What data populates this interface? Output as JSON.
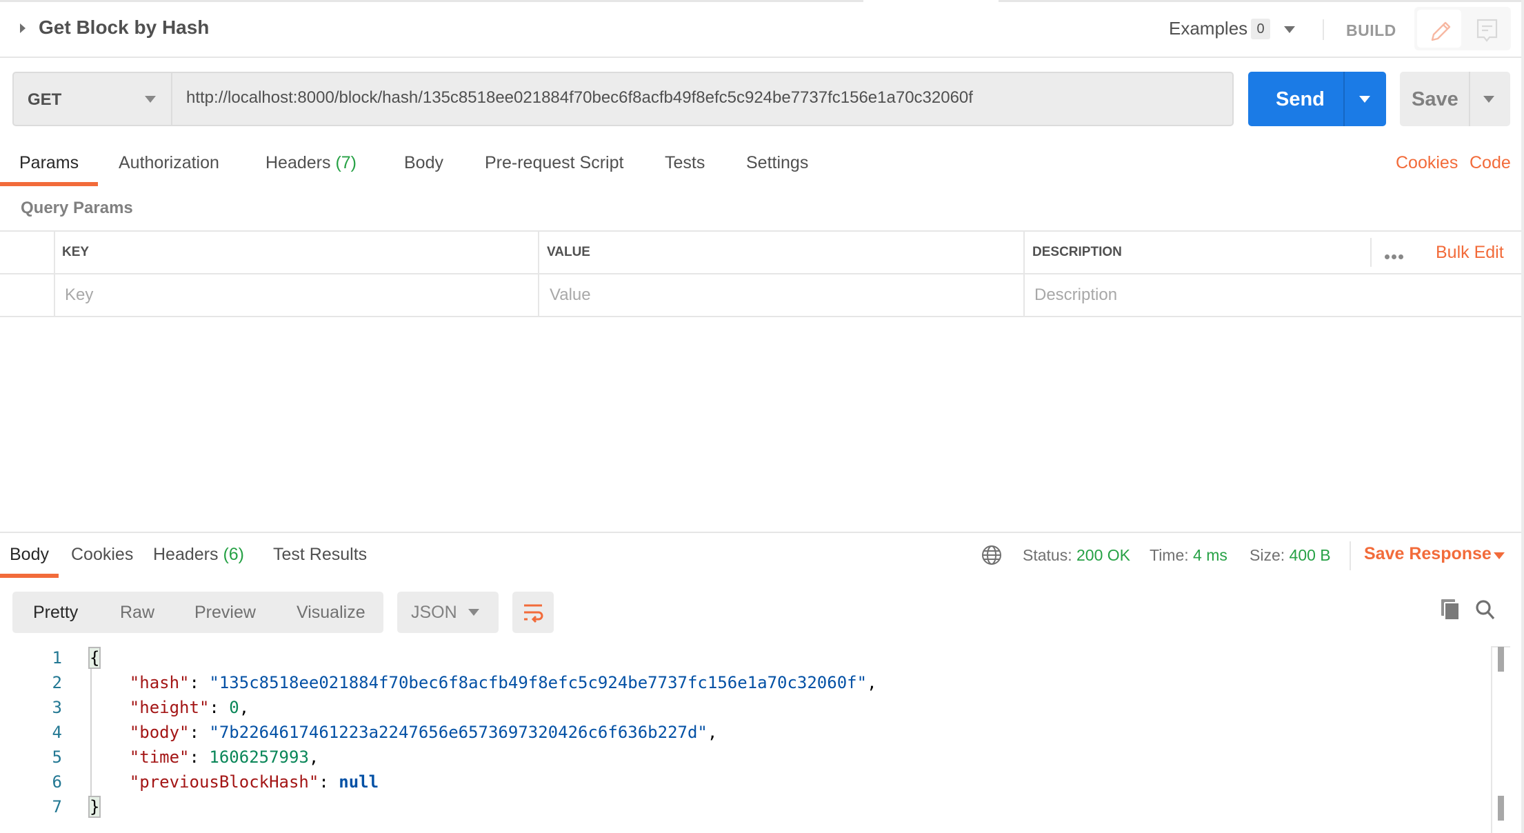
{
  "request": {
    "title": "Get Block by Hash",
    "examples_label": "Examples",
    "examples_count": "0",
    "mode_label": "BUILD",
    "method": "GET",
    "url": "http://localhost:8000/block/hash/135c8518ee021884f70bec6f8acfb49f8efc5c924be7737fc156e1a70c32060f",
    "send_label": "Send",
    "save_label": "Save",
    "tabs": [
      {
        "label": "Params",
        "count": "",
        "active": true
      },
      {
        "label": "Authorization",
        "count": ""
      },
      {
        "label": "Headers",
        "count": "(7)"
      },
      {
        "label": "Body",
        "count": ""
      },
      {
        "label": "Pre-request Script",
        "count": ""
      },
      {
        "label": "Tests",
        "count": ""
      },
      {
        "label": "Settings",
        "count": ""
      }
    ],
    "links": {
      "cookies": "Cookies",
      "code": "Code"
    },
    "query_params": {
      "title": "Query Params",
      "columns": [
        "KEY",
        "VALUE",
        "DESCRIPTION"
      ],
      "placeholders": {
        "key": "Key",
        "value": "Value",
        "description": "Description"
      },
      "bulk_edit_label": "Bulk Edit"
    }
  },
  "response": {
    "tabs": [
      {
        "label": "Body",
        "active": true
      },
      {
        "label": "Cookies"
      },
      {
        "label": "Headers",
        "count": "(6)"
      },
      {
        "label": "Test Results"
      }
    ],
    "status": {
      "label": "Status:",
      "value": "200 OK"
    },
    "time": {
      "label": "Time:",
      "value": "4 ms"
    },
    "size": {
      "label": "Size:",
      "value": "400 B"
    },
    "save_response_label": "Save Response",
    "formats": [
      "Pretty",
      "Raw",
      "Preview",
      "Visualize"
    ],
    "active_format": "Pretty",
    "language": "JSON",
    "body_lines": [
      {
        "num": "1",
        "text": "{"
      },
      {
        "num": "2",
        "key": "\"hash\"",
        "value": "\"135c8518ee021884f70bec6f8acfb49f8efc5c924be7737fc156e1a70c32060f\"",
        "type": "string",
        "trail": ","
      },
      {
        "num": "3",
        "key": "\"height\"",
        "value": "0",
        "type": "number",
        "trail": ","
      },
      {
        "num": "4",
        "key": "\"body\"",
        "value": "\"7b2264617461223a2247656e6573697320426c6f636b227d\"",
        "type": "string",
        "trail": ","
      },
      {
        "num": "5",
        "key": "\"time\"",
        "value": "1606257993",
        "type": "number",
        "trail": ","
      },
      {
        "num": "6",
        "key": "\"previousBlockHash\"",
        "value": "null",
        "type": "keyword",
        "trail": ""
      },
      {
        "num": "7",
        "text": "}"
      }
    ]
  },
  "colors": {
    "accent": "#f26b3a",
    "send": "#1b7be6",
    "success": "#26a145"
  }
}
